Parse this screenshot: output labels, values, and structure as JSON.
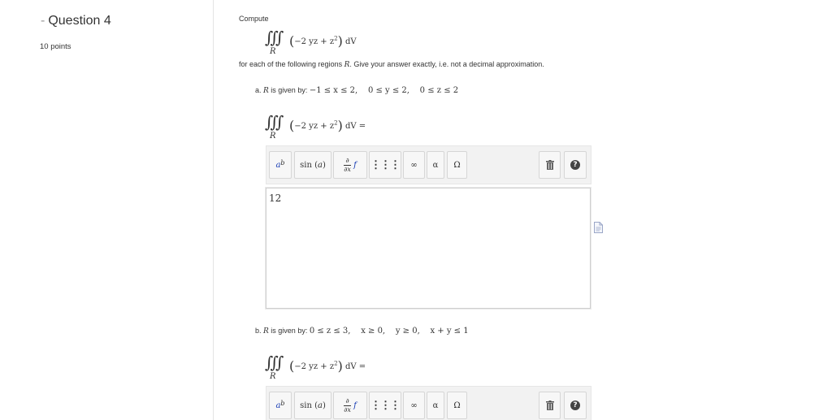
{
  "sidebar": {
    "dash": "-",
    "question_title": "Question 4",
    "points": "10 points"
  },
  "main": {
    "compute_label": "Compute",
    "integral": {
      "symbol": "∭",
      "integrand_open": "(",
      "integrand_expr": "−2 yz + z",
      "integrand_exp": "2",
      "integrand_close": ")",
      "differential": " dV",
      "region": "R"
    },
    "instruction_prefix": "for each of the following regions ",
    "instruction_region": "R",
    "instruction_suffix": ". Give your answer exactly, i.e. not a decimal approximation.",
    "parts": [
      {
        "label": "a. ",
        "region": "R",
        "given_text": " is given by: ",
        "bounds": "−1 ≤ x ≤ 2,    0 ≤ y ≤ 2,    0 ≤ z ≤ 2",
        "equals": " =",
        "answer": "12"
      },
      {
        "label": "b. ",
        "region": "R",
        "given_text": " is given by: ",
        "bounds": "0 ≤ z ≤ 3,    x ≥ 0,    y ≥ 0,    x + y ≤ 1",
        "equals": " ="
      }
    ],
    "toolbar": {
      "power_base": "a",
      "power_exp": "b",
      "sin_label": "sin",
      "sin_arg": "a",
      "deriv_top": "∂",
      "deriv_bottom": "∂x",
      "deriv_f": "f",
      "matrix_label": "⋮⋮⋮",
      "infinity_label": "∞",
      "alpha_label": "α",
      "omega_label": "Ω",
      "help_label": "?"
    }
  }
}
